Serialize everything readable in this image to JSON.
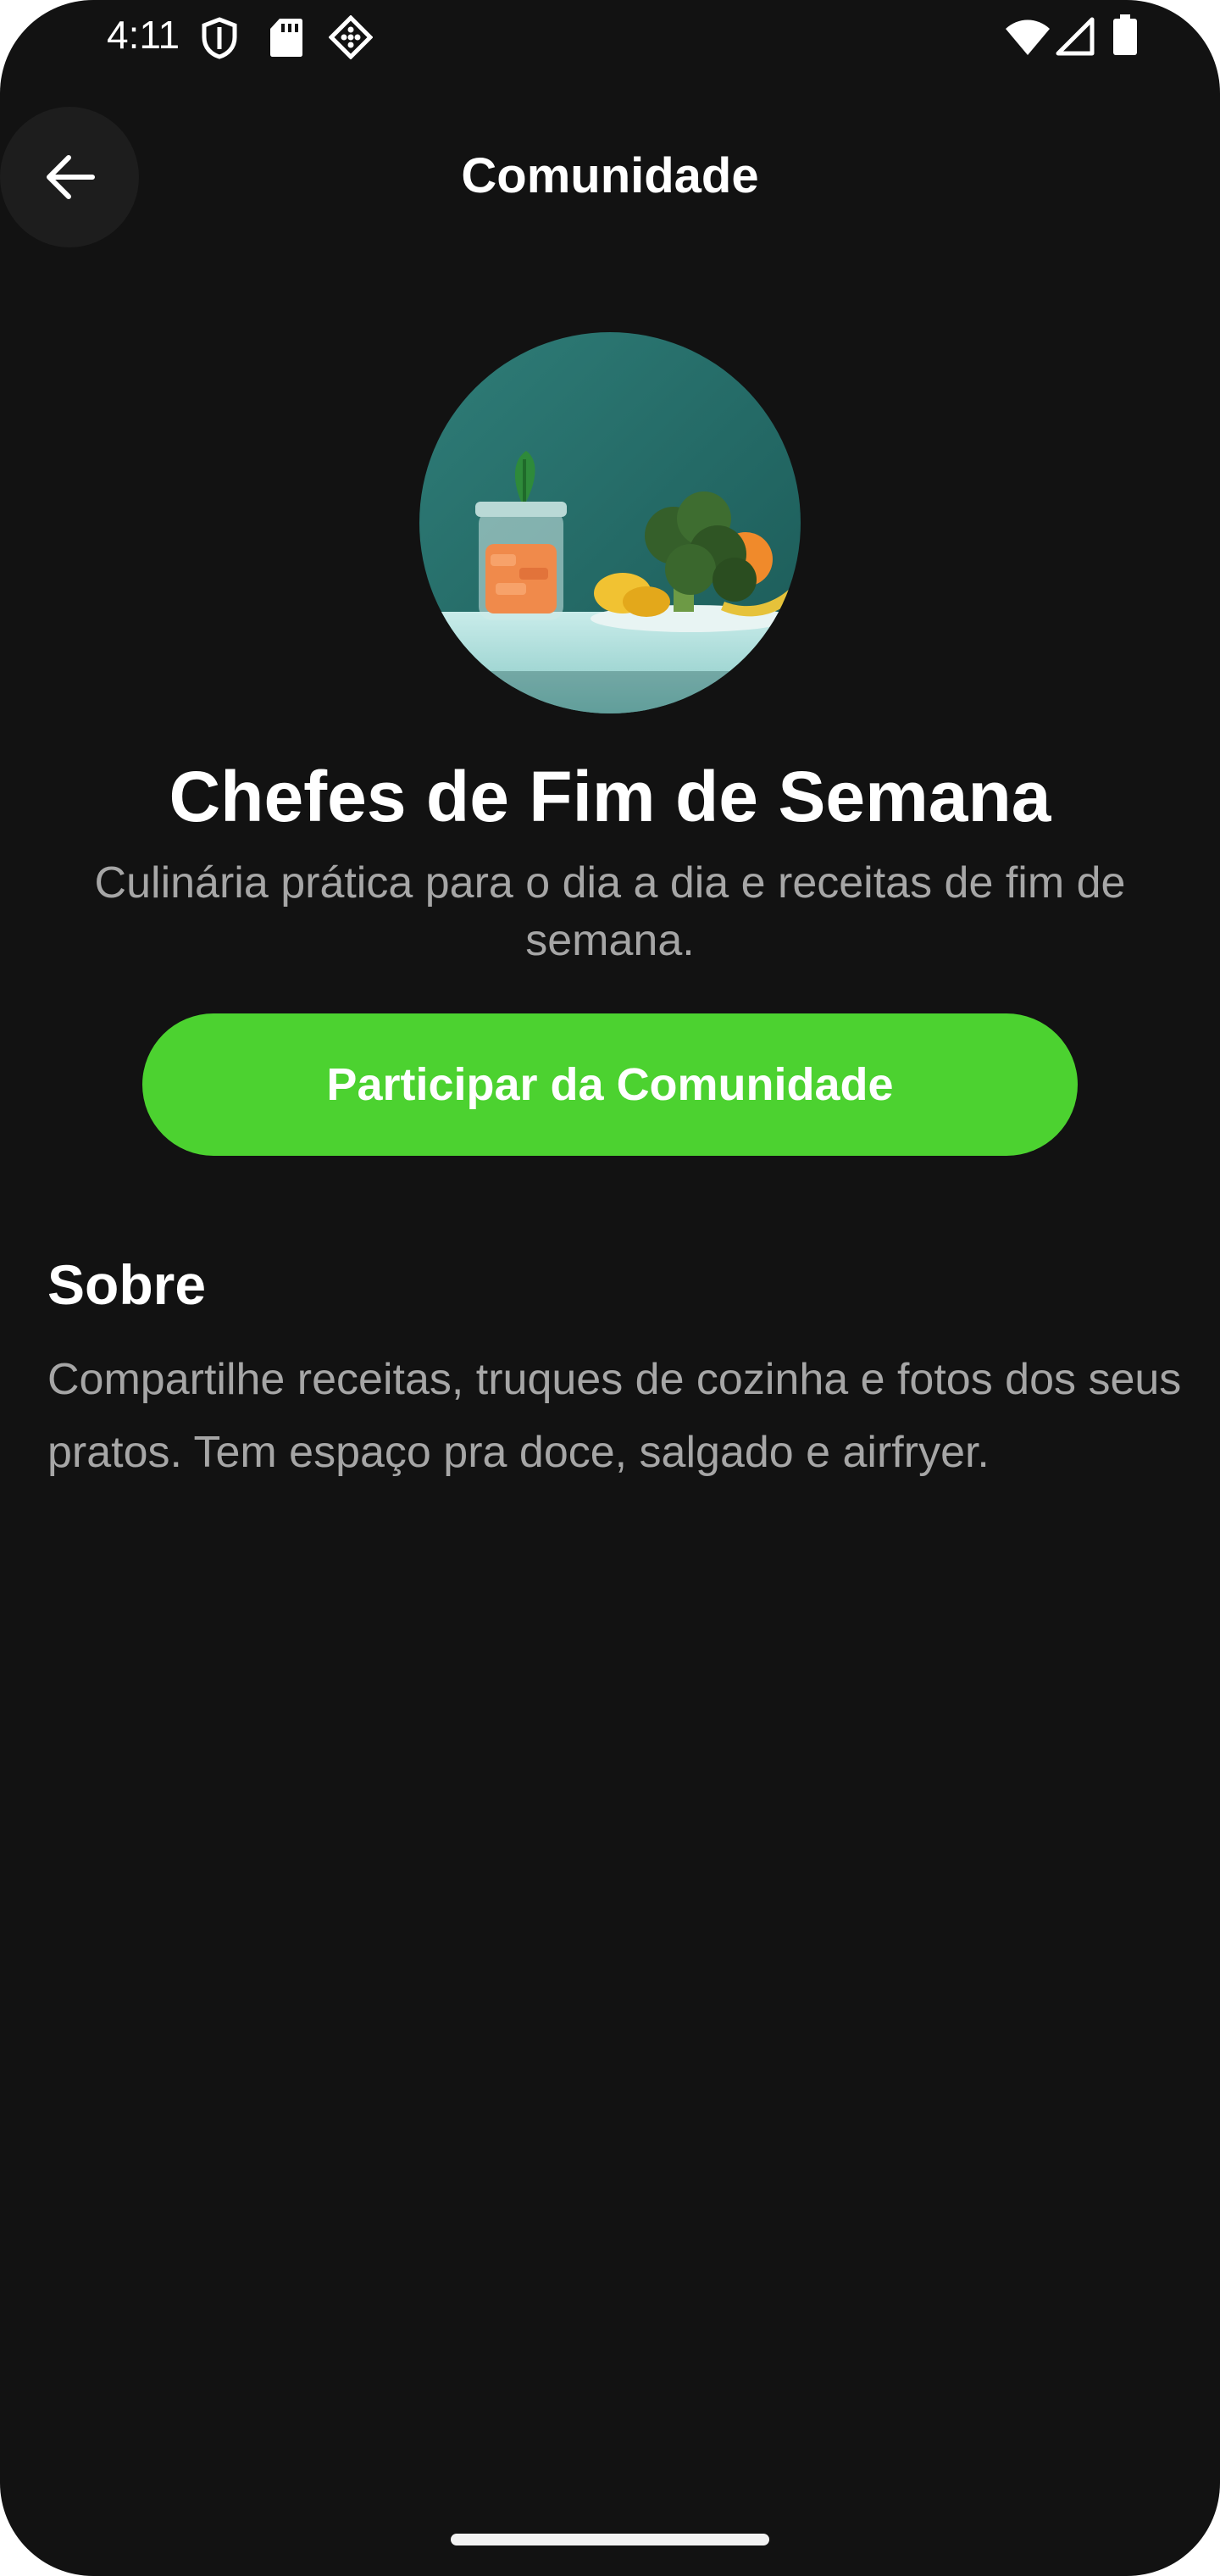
{
  "status_bar": {
    "time": "4:11",
    "left_icons": [
      "shield-icon",
      "sd-card-icon",
      "diamond-dots-icon"
    ],
    "right_icons": [
      "wifi-icon",
      "cell-signal-icon",
      "battery-icon"
    ]
  },
  "app_bar": {
    "title": "Comunidade",
    "back_icon": "arrow-left-icon"
  },
  "community": {
    "name": "Chefes de Fim de Semana",
    "tagline": "Culinária prática para o dia a dia e receitas de fim de semana.",
    "join_label": "Participar da Comunidade",
    "avatar_image": "food-jar-broccoli-photo"
  },
  "about": {
    "heading": "Sobre",
    "text": "Compartilhe receitas, truques de cozinha e fotos dos seus pratos. Tem espaço pra doce, salgado e airfryer."
  },
  "colors": {
    "background": "#121212",
    "accent": "#4cd230",
    "secondary_text": "#a6a6a6"
  }
}
